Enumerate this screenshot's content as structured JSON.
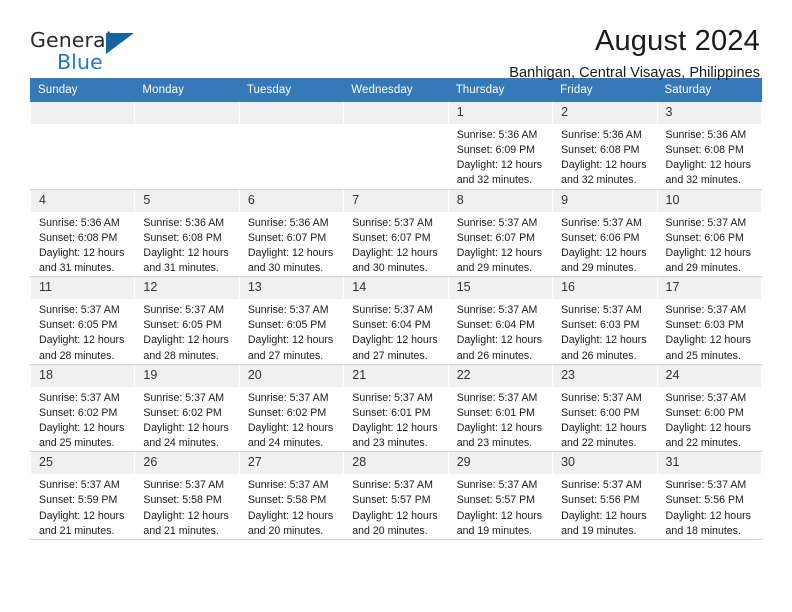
{
  "logo": {
    "word_one": "General",
    "word_two": "Blue",
    "mark": "blue-triangle"
  },
  "header": {
    "month_title": "August 2024",
    "location": "Banhigan, Central Visayas, Philippines"
  },
  "colors": {
    "header_blue": "#3579b9",
    "logo_blue": "#2277c8",
    "daynum_bg": "#f0f0f0",
    "row_divider": "#c8d4de"
  },
  "weekday_headers": [
    "Sunday",
    "Monday",
    "Tuesday",
    "Wednesday",
    "Thursday",
    "Friday",
    "Saturday"
  ],
  "labels": {
    "sunrise_prefix": "Sunrise:",
    "sunset_prefix": "Sunset:",
    "daylight_prefix": "Daylight:"
  },
  "weeks": [
    [
      {
        "day": "",
        "sunrise": "",
        "sunset": "",
        "daylight_line1": "",
        "daylight_line2": ""
      },
      {
        "day": "",
        "sunrise": "",
        "sunset": "",
        "daylight_line1": "",
        "daylight_line2": ""
      },
      {
        "day": "",
        "sunrise": "",
        "sunset": "",
        "daylight_line1": "",
        "daylight_line2": ""
      },
      {
        "day": "",
        "sunrise": "",
        "sunset": "",
        "daylight_line1": "",
        "daylight_line2": ""
      },
      {
        "day": "1",
        "sunrise": "Sunrise: 5:36 AM",
        "sunset": "Sunset: 6:09 PM",
        "daylight_line1": "Daylight: 12 hours",
        "daylight_line2": "and 32 minutes."
      },
      {
        "day": "2",
        "sunrise": "Sunrise: 5:36 AM",
        "sunset": "Sunset: 6:08 PM",
        "daylight_line1": "Daylight: 12 hours",
        "daylight_line2": "and 32 minutes."
      },
      {
        "day": "3",
        "sunrise": "Sunrise: 5:36 AM",
        "sunset": "Sunset: 6:08 PM",
        "daylight_line1": "Daylight: 12 hours",
        "daylight_line2": "and 32 minutes."
      }
    ],
    [
      {
        "day": "4",
        "sunrise": "Sunrise: 5:36 AM",
        "sunset": "Sunset: 6:08 PM",
        "daylight_line1": "Daylight: 12 hours",
        "daylight_line2": "and 31 minutes."
      },
      {
        "day": "5",
        "sunrise": "Sunrise: 5:36 AM",
        "sunset": "Sunset: 6:08 PM",
        "daylight_line1": "Daylight: 12 hours",
        "daylight_line2": "and 31 minutes."
      },
      {
        "day": "6",
        "sunrise": "Sunrise: 5:36 AM",
        "sunset": "Sunset: 6:07 PM",
        "daylight_line1": "Daylight: 12 hours",
        "daylight_line2": "and 30 minutes."
      },
      {
        "day": "7",
        "sunrise": "Sunrise: 5:37 AM",
        "sunset": "Sunset: 6:07 PM",
        "daylight_line1": "Daylight: 12 hours",
        "daylight_line2": "and 30 minutes."
      },
      {
        "day": "8",
        "sunrise": "Sunrise: 5:37 AM",
        "sunset": "Sunset: 6:07 PM",
        "daylight_line1": "Daylight: 12 hours",
        "daylight_line2": "and 29 minutes."
      },
      {
        "day": "9",
        "sunrise": "Sunrise: 5:37 AM",
        "sunset": "Sunset: 6:06 PM",
        "daylight_line1": "Daylight: 12 hours",
        "daylight_line2": "and 29 minutes."
      },
      {
        "day": "10",
        "sunrise": "Sunrise: 5:37 AM",
        "sunset": "Sunset: 6:06 PM",
        "daylight_line1": "Daylight: 12 hours",
        "daylight_line2": "and 29 minutes."
      }
    ],
    [
      {
        "day": "11",
        "sunrise": "Sunrise: 5:37 AM",
        "sunset": "Sunset: 6:05 PM",
        "daylight_line1": "Daylight: 12 hours",
        "daylight_line2": "and 28 minutes."
      },
      {
        "day": "12",
        "sunrise": "Sunrise: 5:37 AM",
        "sunset": "Sunset: 6:05 PM",
        "daylight_line1": "Daylight: 12 hours",
        "daylight_line2": "and 28 minutes."
      },
      {
        "day": "13",
        "sunrise": "Sunrise: 5:37 AM",
        "sunset": "Sunset: 6:05 PM",
        "daylight_line1": "Daylight: 12 hours",
        "daylight_line2": "and 27 minutes."
      },
      {
        "day": "14",
        "sunrise": "Sunrise: 5:37 AM",
        "sunset": "Sunset: 6:04 PM",
        "daylight_line1": "Daylight: 12 hours",
        "daylight_line2": "and 27 minutes."
      },
      {
        "day": "15",
        "sunrise": "Sunrise: 5:37 AM",
        "sunset": "Sunset: 6:04 PM",
        "daylight_line1": "Daylight: 12 hours",
        "daylight_line2": "and 26 minutes."
      },
      {
        "day": "16",
        "sunrise": "Sunrise: 5:37 AM",
        "sunset": "Sunset: 6:03 PM",
        "daylight_line1": "Daylight: 12 hours",
        "daylight_line2": "and 26 minutes."
      },
      {
        "day": "17",
        "sunrise": "Sunrise: 5:37 AM",
        "sunset": "Sunset: 6:03 PM",
        "daylight_line1": "Daylight: 12 hours",
        "daylight_line2": "and 25 minutes."
      }
    ],
    [
      {
        "day": "18",
        "sunrise": "Sunrise: 5:37 AM",
        "sunset": "Sunset: 6:02 PM",
        "daylight_line1": "Daylight: 12 hours",
        "daylight_line2": "and 25 minutes."
      },
      {
        "day": "19",
        "sunrise": "Sunrise: 5:37 AM",
        "sunset": "Sunset: 6:02 PM",
        "daylight_line1": "Daylight: 12 hours",
        "daylight_line2": "and 24 minutes."
      },
      {
        "day": "20",
        "sunrise": "Sunrise: 5:37 AM",
        "sunset": "Sunset: 6:02 PM",
        "daylight_line1": "Daylight: 12 hours",
        "daylight_line2": "and 24 minutes."
      },
      {
        "day": "21",
        "sunrise": "Sunrise: 5:37 AM",
        "sunset": "Sunset: 6:01 PM",
        "daylight_line1": "Daylight: 12 hours",
        "daylight_line2": "and 23 minutes."
      },
      {
        "day": "22",
        "sunrise": "Sunrise: 5:37 AM",
        "sunset": "Sunset: 6:01 PM",
        "daylight_line1": "Daylight: 12 hours",
        "daylight_line2": "and 23 minutes."
      },
      {
        "day": "23",
        "sunrise": "Sunrise: 5:37 AM",
        "sunset": "Sunset: 6:00 PM",
        "daylight_line1": "Daylight: 12 hours",
        "daylight_line2": "and 22 minutes."
      },
      {
        "day": "24",
        "sunrise": "Sunrise: 5:37 AM",
        "sunset": "Sunset: 6:00 PM",
        "daylight_line1": "Daylight: 12 hours",
        "daylight_line2": "and 22 minutes."
      }
    ],
    [
      {
        "day": "25",
        "sunrise": "Sunrise: 5:37 AM",
        "sunset": "Sunset: 5:59 PM",
        "daylight_line1": "Daylight: 12 hours",
        "daylight_line2": "and 21 minutes."
      },
      {
        "day": "26",
        "sunrise": "Sunrise: 5:37 AM",
        "sunset": "Sunset: 5:58 PM",
        "daylight_line1": "Daylight: 12 hours",
        "daylight_line2": "and 21 minutes."
      },
      {
        "day": "27",
        "sunrise": "Sunrise: 5:37 AM",
        "sunset": "Sunset: 5:58 PM",
        "daylight_line1": "Daylight: 12 hours",
        "daylight_line2": "and 20 minutes."
      },
      {
        "day": "28",
        "sunrise": "Sunrise: 5:37 AM",
        "sunset": "Sunset: 5:57 PM",
        "daylight_line1": "Daylight: 12 hours",
        "daylight_line2": "and 20 minutes."
      },
      {
        "day": "29",
        "sunrise": "Sunrise: 5:37 AM",
        "sunset": "Sunset: 5:57 PM",
        "daylight_line1": "Daylight: 12 hours",
        "daylight_line2": "and 19 minutes."
      },
      {
        "day": "30",
        "sunrise": "Sunrise: 5:37 AM",
        "sunset": "Sunset: 5:56 PM",
        "daylight_line1": "Daylight: 12 hours",
        "daylight_line2": "and 19 minutes."
      },
      {
        "day": "31",
        "sunrise": "Sunrise: 5:37 AM",
        "sunset": "Sunset: 5:56 PM",
        "daylight_line1": "Daylight: 12 hours",
        "daylight_line2": "and 18 minutes."
      }
    ]
  ]
}
